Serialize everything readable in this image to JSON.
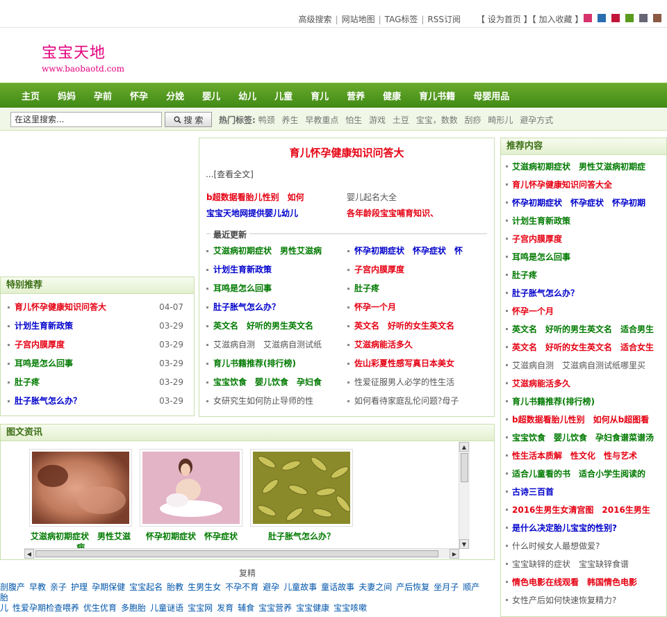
{
  "topbar": {
    "links": [
      "高级搜索",
      "网站地图",
      "TAG标签",
      "RSS订阅"
    ],
    "home_link": "【 设为首页 】",
    "fav_link": "【 加入收藏 】",
    "swatches": [
      "#d6336c",
      "#2a6db0",
      "#c0163a",
      "#5a9a1e",
      "#666677",
      "#8a5a44"
    ]
  },
  "logo": {
    "title": "宝宝天地",
    "url": "www.baobaotd.com"
  },
  "nav": [
    "主页",
    "妈妈",
    "孕前",
    "怀孕",
    "分娩",
    "婴儿",
    "幼儿",
    "儿童",
    "育儿",
    "营养",
    "健康",
    "育儿书籍",
    "母婴用品"
  ],
  "search": {
    "value": "在这里搜索...",
    "button": "搜 索",
    "hot_label": "热门标签:",
    "hot_tags": [
      "鸭颈",
      "养生",
      "早教重点",
      "怕生",
      "游戏",
      "土豆",
      "宝宝，数数",
      "刮痧",
      "畸形儿",
      "避孕方式"
    ]
  },
  "special": {
    "title": "特别推荐",
    "items": [
      {
        "text": "育儿怀孕健康知识问答大",
        "date": "04-07",
        "color": "red"
      },
      {
        "text": "计划生育新政策",
        "date": "03-29",
        "color": "blue"
      },
      {
        "text": "子宫内膜厚度",
        "date": "03-29",
        "color": "red"
      },
      {
        "text": "耳鸣是怎么回事",
        "date": "03-29",
        "color": "green"
      },
      {
        "text": "肚子疼",
        "date": "03-29",
        "color": "green"
      },
      {
        "text": "肚子胀气怎么办？",
        "date": "03-29",
        "color": "blue"
      }
    ]
  },
  "center": {
    "title": "育儿怀孕健康知识问答大",
    "view_all": "...[查看全文]",
    "pairs": [
      {
        "text": "b超数据看胎儿性别　如何",
        "color": "red"
      },
      {
        "text": "婴儿起名大全",
        "color": "gray"
      },
      {
        "text": "宝宝天地网提供婴儿幼儿",
        "color": "blue"
      },
      {
        "text": "各年龄段宝宝哺育知识、",
        "color": "red"
      }
    ],
    "recent_label": "最近更新",
    "recent": [
      {
        "text": "艾滋病初期症状　男性艾滋病",
        "color": "green"
      },
      {
        "text": "怀孕初期症状　怀孕症状　怀",
        "color": "blue"
      },
      {
        "text": "计划生育新政策",
        "color": "blue"
      },
      {
        "text": "子宫内膜厚度",
        "color": "red"
      },
      {
        "text": "耳鸣是怎么回事",
        "color": "green"
      },
      {
        "text": "肚子疼",
        "color": "green"
      },
      {
        "text": "肚子胀气怎么办？",
        "color": "blue"
      },
      {
        "text": "怀孕一个月",
        "color": "red"
      },
      {
        "text": "英文名　好听的男生英文名",
        "color": "green"
      },
      {
        "text": "英文名　好听的女生英文名",
        "color": "red"
      },
      {
        "text": "艾滋病自测　艾滋病自测试纸",
        "color": "gray"
      },
      {
        "text": "艾滋病能活多久",
        "color": "red"
      },
      {
        "text": "育儿书籍推荐(排行榜)",
        "color": "green"
      },
      {
        "text": "佐山彩夏性感写真日本美女",
        "color": "red"
      },
      {
        "text": "宝宝饮食　婴儿饮食　孕妇食",
        "color": "green"
      },
      {
        "text": "性爱征服男人必学的性生活",
        "color": "gray"
      },
      {
        "text": "女研究生如何防止导师的性",
        "color": "gray"
      },
      {
        "text": "如何看待家庭乱伦问题?母子",
        "color": "gray"
      }
    ]
  },
  "picnews": {
    "title": "图文资讯",
    "items": [
      {
        "caption": "艾滋病初期症状　男性艾滋",
        "tail": "病"
      },
      {
        "caption": "怀孕初期症状　怀孕症状",
        "tail": ""
      },
      {
        "caption": "肚子胀气怎么办？",
        "tail": ""
      }
    ]
  },
  "footer": {
    "label": "复精",
    "tags_line1": [
      "剖腹产",
      "早教",
      "亲子",
      "护理",
      "孕期保健",
      "宝宝起名",
      "胎教",
      "生男生女",
      "不孕不育",
      "避孕",
      "儿童故事",
      "童话故事",
      "夫妻之间",
      "产后恢复",
      "坐月子",
      "顺产",
      "胎"
    ],
    "tags_line2": [
      "儿",
      "性爱孕期检查喂养",
      "优生优育",
      "多胞胎",
      "儿童谜语",
      "宝宝网",
      "发育",
      "辅食",
      "宝宝营养",
      "宝宝健康",
      "宝宝咳嗽"
    ]
  },
  "recommend": {
    "title": "推荐内容",
    "items": [
      {
        "text": "艾滋病初期症状　男性艾滋病初期症",
        "color": "green"
      },
      {
        "text": "育儿怀孕健康知识问答大全",
        "color": "red"
      },
      {
        "text": "怀孕初期症状　怀孕症状　怀孕初期",
        "color": "blue"
      },
      {
        "text": "计划生育新政策",
        "color": "green"
      },
      {
        "text": "子宫内膜厚度",
        "color": "red"
      },
      {
        "text": "耳鸣是怎么回事",
        "color": "green"
      },
      {
        "text": "肚子疼",
        "color": "green"
      },
      {
        "text": "肚子胀气怎么办？",
        "color": "blue"
      },
      {
        "text": "怀孕一个月",
        "color": "red"
      },
      {
        "text": "英文名　好听的男生英文名　适合男生",
        "color": "green"
      },
      {
        "text": "英文名　好听的女生英文名　适合女生",
        "color": "red"
      },
      {
        "text": "艾滋病自测　艾滋病自测试纸哪里买",
        "color": "gray"
      },
      {
        "text": "艾滋病能活多久",
        "color": "red"
      },
      {
        "text": "育儿书籍推荐(排行榜)",
        "color": "green"
      },
      {
        "text": "b超数据看胎儿性别　如何从b超图看",
        "color": "red"
      },
      {
        "text": "宝宝饮食　婴儿饮食　孕妇食谱菜谱汤",
        "color": "green"
      },
      {
        "text": "性生活本质解　性文化　性与艺术",
        "color": "red"
      },
      {
        "text": "适合儿童看的书　适合小学生阅读的",
        "color": "green"
      },
      {
        "text": "古诗三百首",
        "color": "blue"
      },
      {
        "text": "2016生男生女清宫图　2016生男生",
        "color": "red"
      },
      {
        "text": "是什么决定胎儿宝宝的性别?",
        "color": "blue"
      },
      {
        "text": "什么时候女人最想做爱?",
        "color": "gray"
      },
      {
        "text": "宝宝缺锌的症状　宝宝缺锌食谱",
        "color": "gray"
      },
      {
        "text": "情色电影在线观看　韩国情色电影",
        "color": "red"
      },
      {
        "text": "女性产后如何快速恢复精力?",
        "color": "gray"
      }
    ]
  }
}
